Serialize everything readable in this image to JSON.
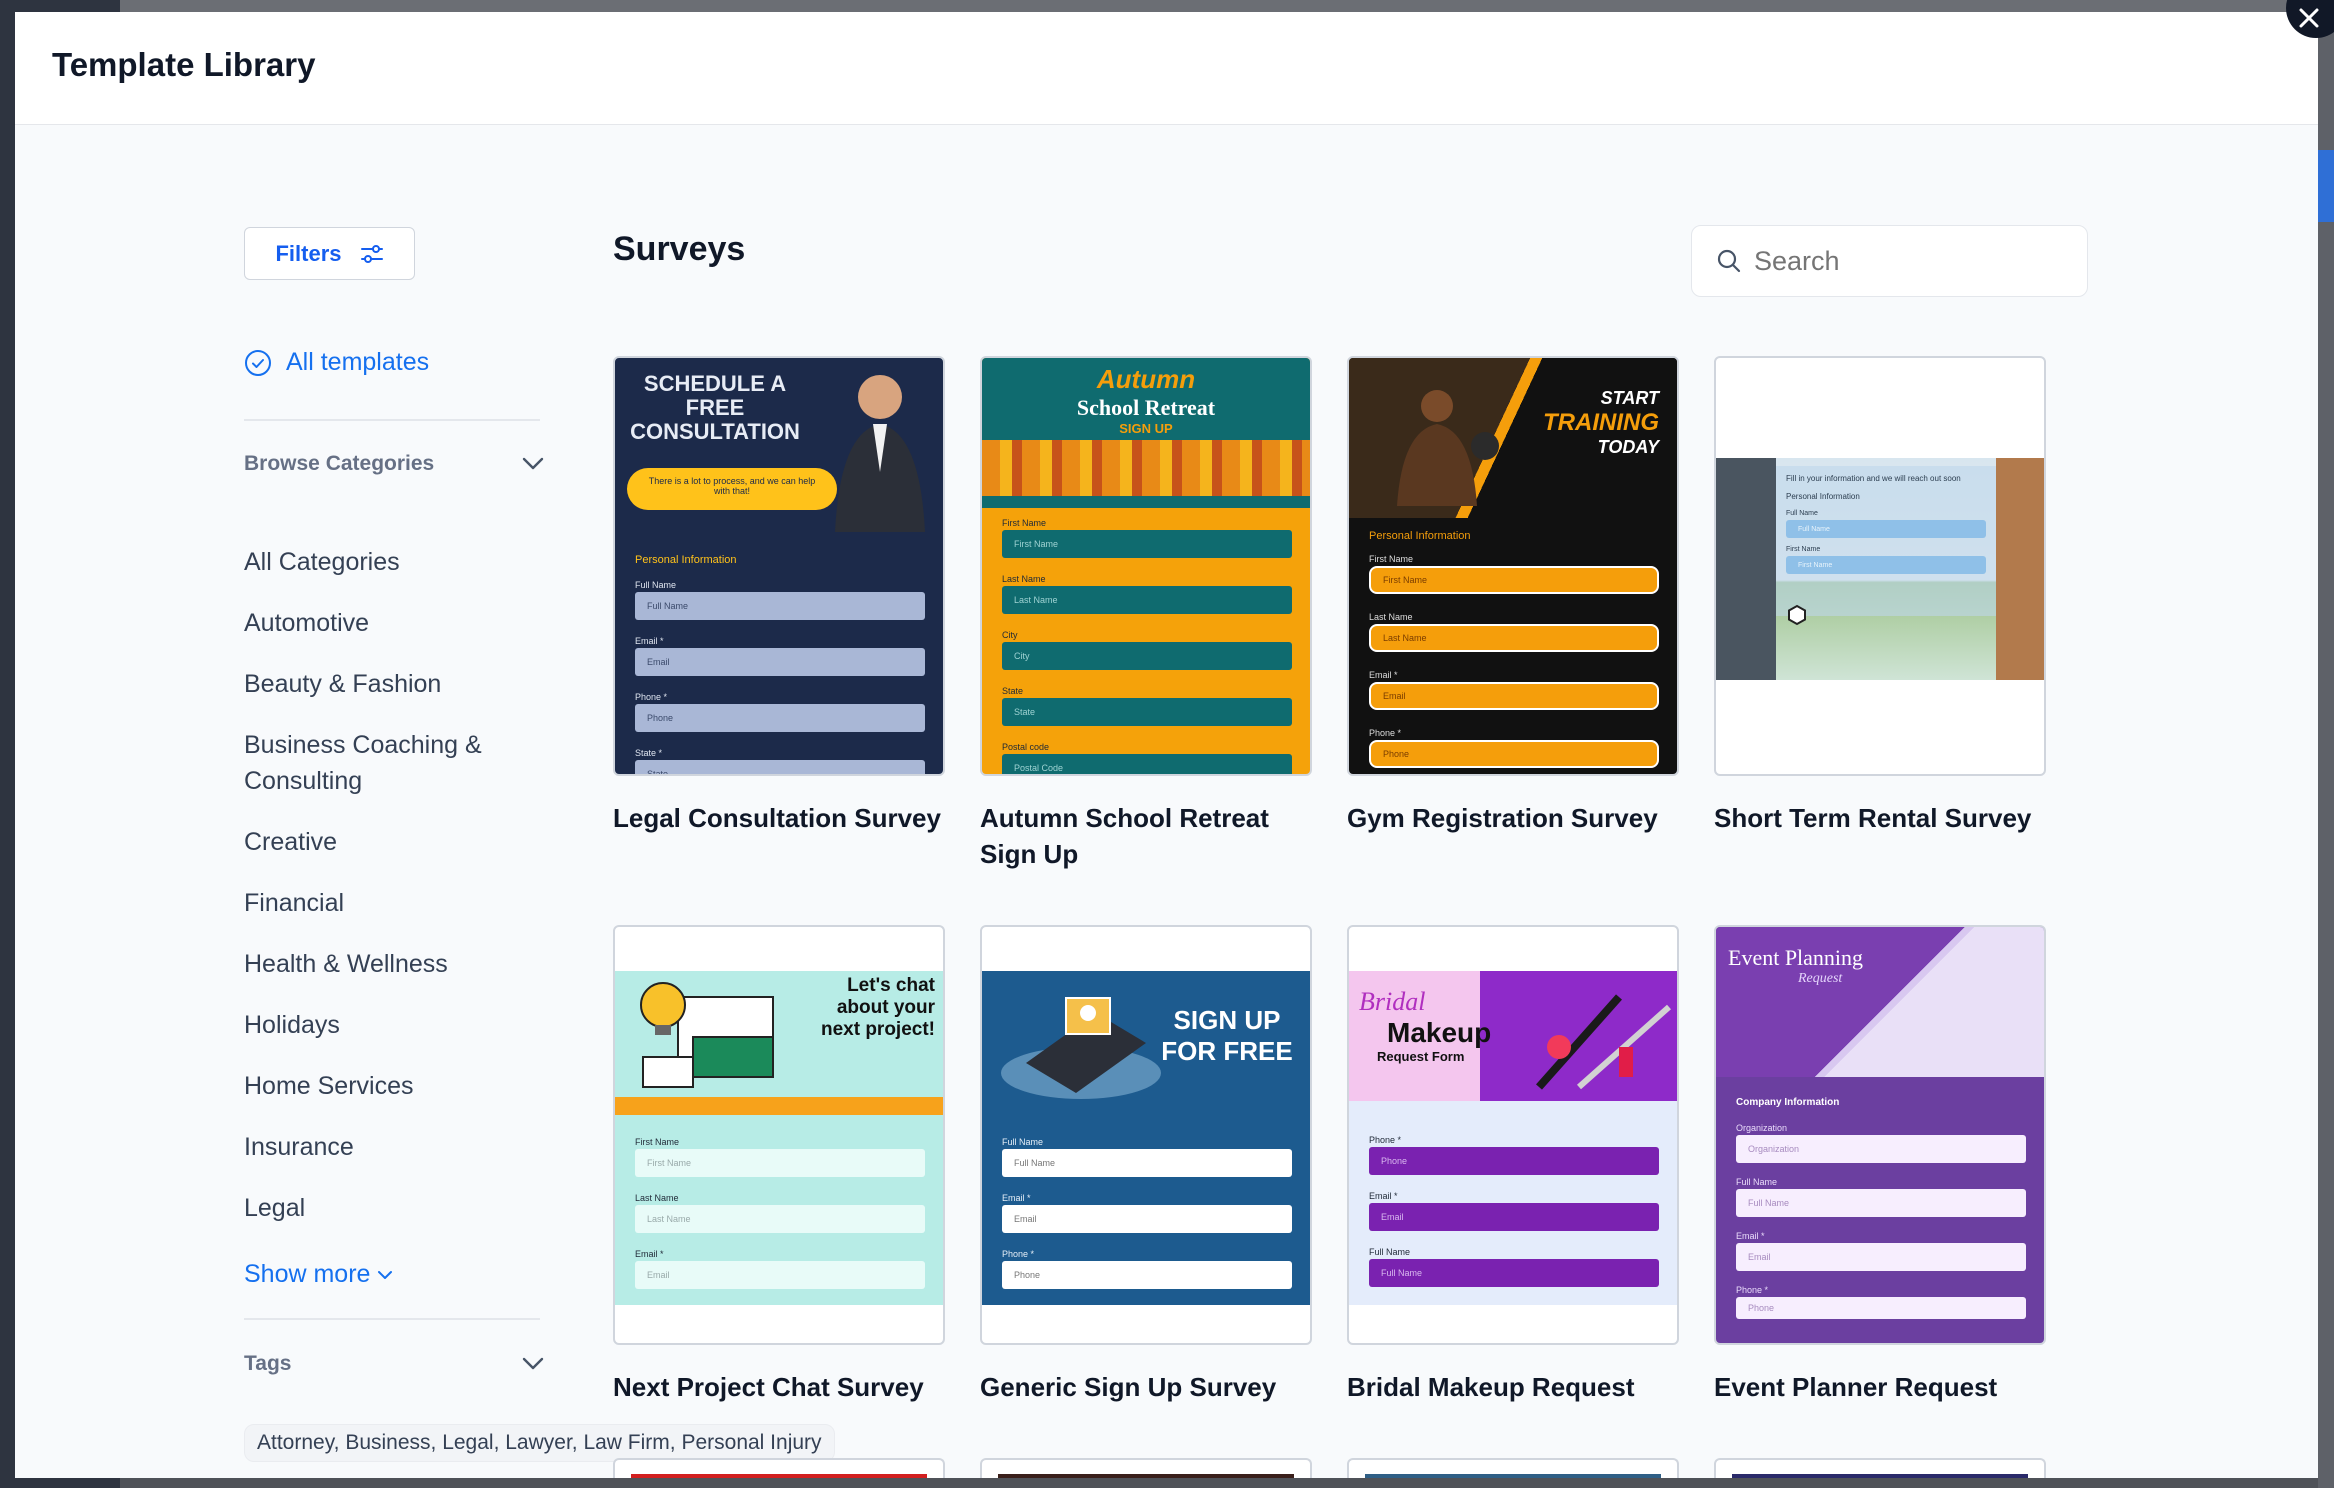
{
  "window": {
    "title": "Template Library",
    "close_icon": "close-icon"
  },
  "sidebar": {
    "filters_label": "Filters",
    "all_templates_label": "All templates",
    "browse_categories_label": "Browse Categories",
    "categories": [
      "All Categories",
      "Automotive",
      "Beauty & Fashion",
      "Business Coaching & Consulting",
      "Creative",
      "Financial",
      "Health & Wellness",
      "Holidays",
      "Home Services",
      "Insurance",
      "Legal"
    ],
    "show_more_label": "Show more",
    "tags_label": "Tags",
    "tag_values": "Attorney, Business, Legal, Lawyer, Law Firm, Personal Injury"
  },
  "main": {
    "section_title": "Surveys",
    "search_placeholder": "Search",
    "templates": [
      {
        "title": "Legal Consultation Survey",
        "banner": [
          "SCHEDULE A",
          "FREE",
          "CONSULTATION"
        ],
        "callout": "There is a lot to process, and we can help with that!",
        "section": "Personal Information",
        "labels": [
          "Full Name",
          "Email *",
          "Phone *",
          "State *"
        ],
        "placeholders": [
          "Full Name",
          "Email",
          "Phone",
          "State"
        ]
      },
      {
        "title": "Autumn School Retreat Sign Up",
        "banner": [
          "Autumn",
          "School Retreat",
          "SIGN UP"
        ],
        "labels": [
          "First Name",
          "Last Name",
          "City",
          "State",
          "Postal code"
        ],
        "placeholders": [
          "First Name",
          "Last Name",
          "City",
          "State",
          "Postal Code"
        ]
      },
      {
        "title": "Gym Registration Survey",
        "banner": [
          "START",
          "TRAINING",
          "TODAY"
        ],
        "section": "Personal Information",
        "labels": [
          "First Name",
          "Last Name",
          "Email *",
          "Phone *"
        ],
        "placeholders": [
          "First Name",
          "Last Name",
          "Email",
          "Phone"
        ]
      },
      {
        "title": "Short Term Rental Survey",
        "banner_text": "Fill in your information and we will reach out soon",
        "section": "Personal Information",
        "labels": [
          "Full Name",
          "First Name"
        ],
        "placeholders": [
          "Full Name",
          "First Name"
        ]
      },
      {
        "title": "Next Project Chat Survey",
        "banner": [
          "Let's chat",
          "about your",
          "next project!"
        ],
        "labels": [
          "First Name",
          "Last Name",
          "Email *"
        ],
        "placeholders": [
          "First Name",
          "Last Name",
          "Email"
        ]
      },
      {
        "title": "Generic Sign Up Survey",
        "banner": [
          "SIGN UP",
          "FOR FREE"
        ],
        "labels": [
          "Full Name",
          "Email *",
          "Phone *"
        ],
        "placeholders": [
          "Full Name",
          "Email",
          "Phone"
        ]
      },
      {
        "title": "Bridal Makeup Request",
        "banner": [
          "Bridal",
          "Makeup",
          "Request Form"
        ],
        "labels": [
          "Phone *",
          "Email *",
          "Full Name"
        ],
        "placeholders": [
          "Phone",
          "Email",
          "Full Name"
        ]
      },
      {
        "title": "Event Planner Request",
        "banner": [
          "Event Planning",
          "Request"
        ],
        "section": "Company Information",
        "labels": [
          "Organization",
          "Full Name",
          "Email *",
          "Phone *"
        ],
        "placeholders": [
          "Organization",
          "Full Name",
          "Email",
          "Phone"
        ]
      }
    ]
  },
  "colors": {
    "primary_blue": "#1570ef",
    "heading": "#101828",
    "border": "#d0d5dd"
  }
}
